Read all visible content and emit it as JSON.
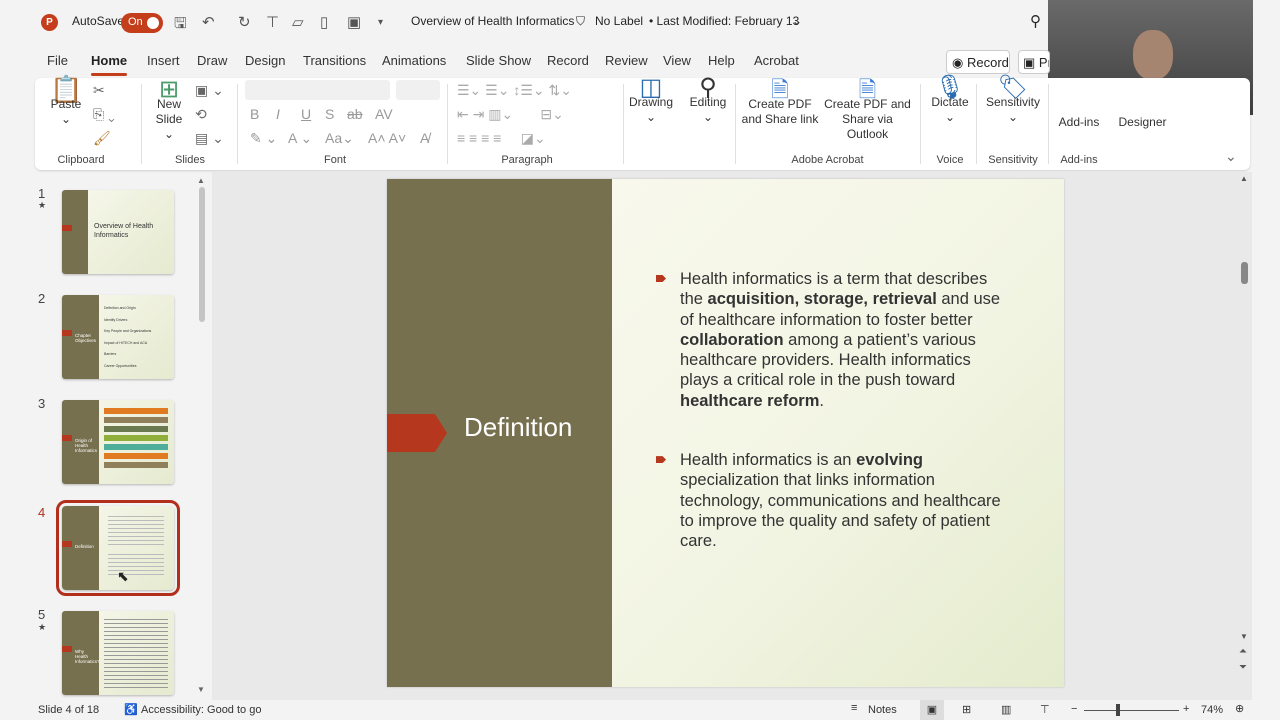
{
  "titlebar": {
    "autosave_label": "AutoSave",
    "autosave_state": "On",
    "doc_title": "Overview of Health Informatics",
    "label": "No Label",
    "modified": "• Last Modified: February 13"
  },
  "tabs": [
    "File",
    "Home",
    "Insert",
    "Draw",
    "Design",
    "Transitions",
    "Animations",
    "Slide Show",
    "Record",
    "Review",
    "View",
    "Help",
    "Acrobat"
  ],
  "record_button": "Record",
  "present_button": "Pr",
  "ribbon": {
    "paste": "Paste",
    "new_slide": "New",
    "new_slide2": "Slide",
    "bold": "B",
    "italic": "I",
    "underline": "U",
    "strike": "S",
    "drawing": "Drawing",
    "editing": "Editing",
    "create_pdf_link_1": "Create PDF",
    "create_pdf_link_2": "and Share link",
    "create_pdf_outlook_1": "Create PDF and",
    "create_pdf_outlook_2": "Share via Outlook",
    "dictate": "Dictate",
    "sensitivity": "Sensitivity",
    "addins": "Add-ins",
    "designer": "Designer",
    "groups": {
      "clipboard": "Clipboard",
      "slides": "Slides",
      "font": "Font",
      "paragraph": "Paragraph",
      "acrobat": "Adobe Acrobat",
      "voice": "Voice",
      "sensitivity": "Sensitivity",
      "addins": "Add-ins"
    }
  },
  "thumbnails": [
    {
      "num": "1",
      "title": "Overview of Health Informatics"
    },
    {
      "num": "2",
      "title": "Chapter Objectives",
      "items": [
        "Definition and Origin",
        "Identify Drivers",
        "Key People and Organizations",
        "Impact of HITECH and ACA",
        "Barriers",
        "Career Opportunities"
      ]
    },
    {
      "num": "3",
      "title": "Origin of Health Informatics"
    },
    {
      "num": "4",
      "title": "Definition"
    },
    {
      "num": "5",
      "title": "Why Health Informatics?"
    }
  ],
  "slide": {
    "heading": "Definition",
    "bullet1": [
      {
        "t": "Health informatics is a term that describes the "
      },
      {
        "b": "acquisition, storage, retrieval"
      },
      {
        "t": " and use of healthcare information to foster better "
      },
      {
        "b": "collaboration"
      },
      {
        "t": " among a patient’s various healthcare providers. Health informatics plays a critical role in the push toward "
      },
      {
        "b": "healthcare reform"
      },
      {
        "t": "."
      }
    ],
    "bullet2": [
      {
        "t": "Health informatics is an "
      },
      {
        "b": "evolving"
      },
      {
        "t": " specialization that links information technology, communications and healthcare to improve the quality and safety of patient care."
      }
    ]
  },
  "status": {
    "slide_count": "Slide 4 of 18",
    "accessibility": "Accessibility: Good to go",
    "notes": "Notes",
    "zoom": "74%"
  },
  "colors": {
    "accent": "#c43e1c",
    "band": "#77704f",
    "arrow": "#b5371d"
  }
}
